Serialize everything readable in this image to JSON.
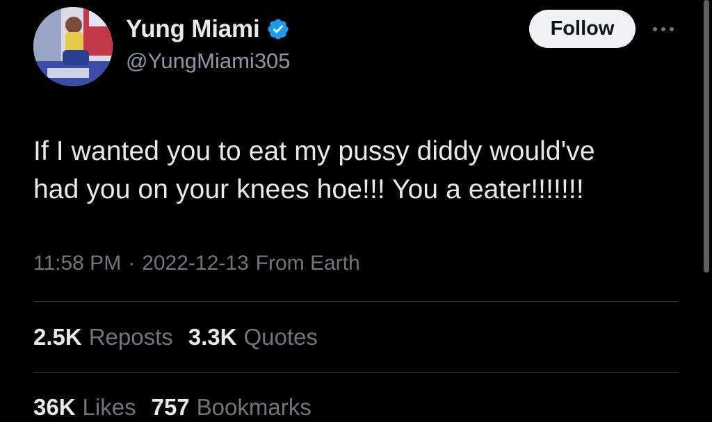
{
  "author": {
    "display_name": "Yung Miami",
    "handle": "@YungMiami305",
    "verified_icon": "verified-badge-icon",
    "verified_color": "#1d9bf0"
  },
  "actions": {
    "follow_label": "Follow",
    "more_icon": "more-options-icon"
  },
  "tweet": {
    "text_line_1": "If I wanted you to eat my pussy diddy would've",
    "text_line_2": "had you on your knees hoe!!! You a eater!!!!!!!",
    "time": "11:58 PM",
    "separator": "·",
    "date": "2022-12-13",
    "source": "From Earth"
  },
  "stats": {
    "reposts": {
      "count": "2.5K",
      "label": "Reposts"
    },
    "quotes": {
      "count": "3.3K",
      "label": "Quotes"
    },
    "likes": {
      "count": "36K",
      "label": "Likes"
    },
    "bookmarks": {
      "count": "757",
      "label": "Bookmarks"
    }
  },
  "colors": {
    "background": "#000000",
    "text": "#e7e9ea",
    "muted": "#71767b",
    "divider": "#2f3336",
    "follow_bg": "#eff3f4"
  }
}
